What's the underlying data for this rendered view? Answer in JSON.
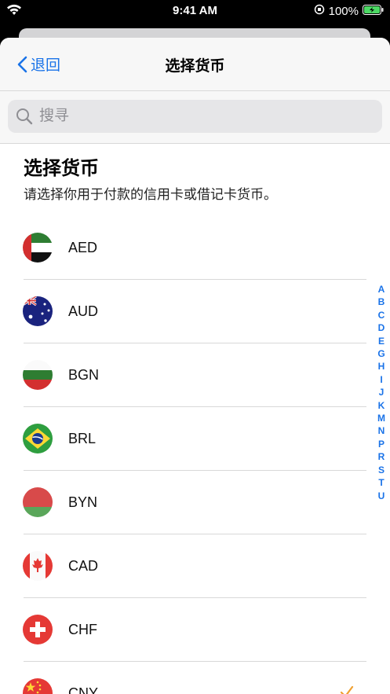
{
  "status": {
    "time": "9:41 AM",
    "battery": "100%"
  },
  "nav": {
    "back_label": "退回",
    "title": "选择货币"
  },
  "search": {
    "placeholder": "搜寻"
  },
  "heading": "选择货币",
  "subtitle": "请选择你用于付款的信用卡或借记卡货币。",
  "currencies": [
    {
      "code": "AED"
    },
    {
      "code": "AUD"
    },
    {
      "code": "BGN"
    },
    {
      "code": "BRL"
    },
    {
      "code": "BYN"
    },
    {
      "code": "CAD"
    },
    {
      "code": "CHF"
    },
    {
      "code": "CNY",
      "selected": true
    }
  ],
  "index_letters": [
    "A",
    "B",
    "C",
    "D",
    "E",
    "G",
    "H",
    "I",
    "J",
    "K",
    "M",
    "N",
    "P",
    "R",
    "S",
    "T",
    "U"
  ],
  "colors": {
    "accent": "#1a73e8",
    "check": "#f0a030",
    "battery": "#4cd964"
  }
}
